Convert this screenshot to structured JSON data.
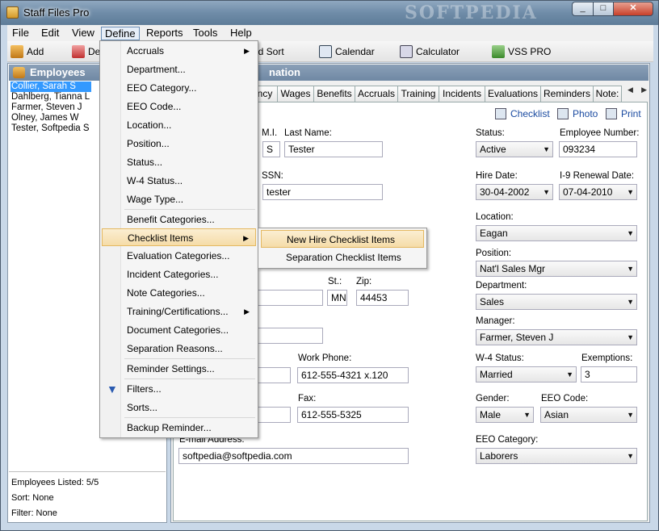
{
  "window": {
    "title": "Staff Files Pro",
    "watermark": "SOFTPEDIA"
  },
  "menubar": [
    {
      "label": "File"
    },
    {
      "label": "Edit"
    },
    {
      "label": "View"
    },
    {
      "label": "Define"
    },
    {
      "label": "Reports"
    },
    {
      "label": "Tools"
    },
    {
      "label": "Help"
    }
  ],
  "toolbar": {
    "add": "Add",
    "delete": "De",
    "find_sort": "nd Sort",
    "calendar": "Calendar",
    "calculator": "Calculator",
    "vss": "VSS PRO"
  },
  "left_pane": {
    "header": "Employees",
    "employees": [
      "Collier, Sarah S",
      "Dahlberg, Tianna L",
      "Farmer, Steven J",
      "Olney, James W",
      "Tester, Softpedia S"
    ],
    "listed": "Employees Listed: 5/5",
    "sort": "Sort: None",
    "filter": "Filter: None"
  },
  "right_pane": {
    "header": "nation",
    "tabs": [
      "ncy",
      "Wages",
      "Benefits",
      "Accruals",
      "Training",
      "Incidents",
      "Evaluations",
      "Reminders",
      "Note:"
    ],
    "actions": {
      "checklist": "Checklist",
      "photo": "Photo",
      "print": "Print"
    }
  },
  "form": {
    "mi_label": "M.I.",
    "mi": "S",
    "last_name_label": "Last Name:",
    "last_name": "Tester",
    "ssn_label": "SSN:",
    "ssn": "tester",
    "st_label": "St.:",
    "st": "MN",
    "zip_label": "Zip:",
    "zip": "44453",
    "work_phone_label": "Work Phone:",
    "work_phone": "612-555-4321 x.120",
    "fax_label": "Fax:",
    "fax": "612-555-5325",
    "email_label": "E-mail Address:",
    "email": "softpedia@softpedia.com",
    "status_label": "Status:",
    "status": "Active",
    "emp_num_label": "Employee Number:",
    "emp_num": "093234",
    "hire_date_label": "Hire Date:",
    "hire_date": "30-04-2002",
    "i9_label": "I-9 Renewal Date:",
    "i9": "07-04-2010",
    "location_label": "Location:",
    "location": "Eagan",
    "position_label": "Position:",
    "position": "Nat'l Sales Mgr",
    "department_label": "Department:",
    "department": "Sales",
    "manager_label": "Manager:",
    "manager": "Farmer, Steven J",
    "w4_label": "W-4 Status:",
    "w4": "Married",
    "exemptions_label": "Exemptions:",
    "exemptions": "3",
    "gender_label": "Gender:",
    "gender": "Male",
    "eeo_code_label": "EEO Code:",
    "eeo_code": "Asian",
    "eeo_cat_label": "EEO Category:",
    "eeo_cat": "Laborers"
  },
  "define_menu": [
    "Accruals",
    "Department...",
    "EEO Category...",
    "EEO Code...",
    "Location...",
    "Position...",
    "Status...",
    "W-4 Status...",
    "Wage Type...",
    "Benefit Categories...",
    "Checklist Items",
    "Evaluation Categories...",
    "Incident Categories...",
    "Note Categories...",
    "Training/Certifications...",
    "Document Categories...",
    "Separation Reasons...",
    "Reminder Settings...",
    "Filters...",
    "Sorts...",
    "Backup Reminder..."
  ],
  "checklist_submenu": [
    "New Hire Checklist Items",
    "Separation Checklist Items"
  ]
}
